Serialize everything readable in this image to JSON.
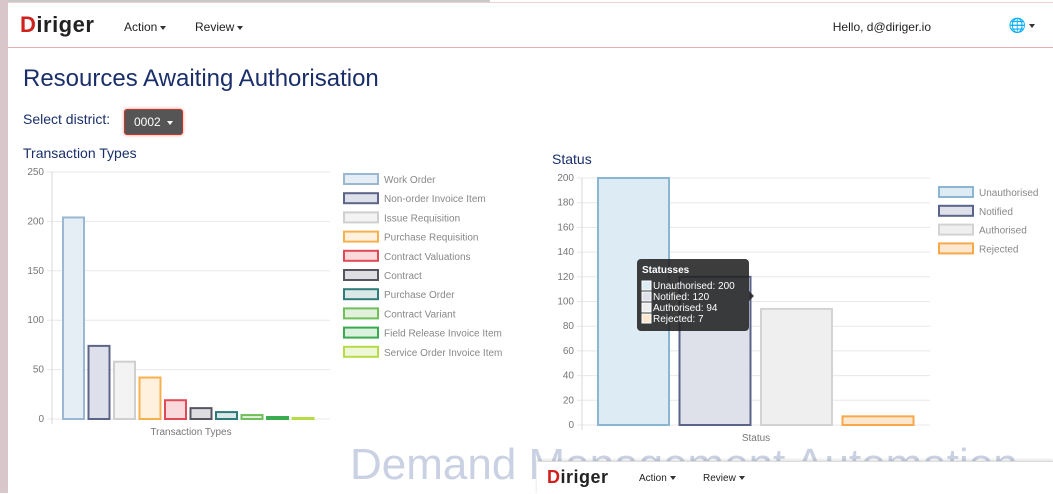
{
  "app": {
    "brand_d": "D",
    "brand_rest": "iriger"
  },
  "nav": {
    "action_label": "Action",
    "review_label": "Review",
    "hello_text": "Hello, d@diriger.io"
  },
  "page": {
    "title": "Resources Awaiting Authorisation",
    "district_label": "Select district:",
    "district_value": "0002"
  },
  "watermark": "Demand Management Automation",
  "chart_data": [
    {
      "type": "bar",
      "title": "Transaction Types",
      "xlabel": "Transaction Types",
      "ylim": [
        0,
        250
      ],
      "yticks": [
        0,
        50,
        100,
        150,
        200,
        250
      ],
      "grid": true,
      "legend": "right",
      "series": [
        {
          "name": "Work Order",
          "value": 204,
          "fill": "#e6eef5",
          "stroke": "#9ab8d1"
        },
        {
          "name": "Non-order Invoice Item",
          "value": 74,
          "fill": "#dde0ea",
          "stroke": "#5c6487"
        },
        {
          "name": "Issue Requisition",
          "value": 58,
          "fill": "#f3f3f3",
          "stroke": "#cfcfcf"
        },
        {
          "name": "Purchase Requisition",
          "value": 42,
          "fill": "#fff1de",
          "stroke": "#f6b14f"
        },
        {
          "name": "Contract Valuations",
          "value": 19,
          "fill": "#f9d9dc",
          "stroke": "#e04a56"
        },
        {
          "name": "Contract",
          "value": 11,
          "fill": "#dedee2",
          "stroke": "#555560"
        },
        {
          "name": "Purchase Order",
          "value": 7,
          "fill": "#dbe8e8",
          "stroke": "#2f7b7b"
        },
        {
          "name": "Contract Variant",
          "value": 4,
          "fill": "#e2f1dc",
          "stroke": "#6fbf5a"
        },
        {
          "name": "Field Release Invoice Item",
          "value": 2,
          "fill": "#d9f1dd",
          "stroke": "#3aab51"
        },
        {
          "name": "Service Order Invoice Item",
          "value": 1,
          "fill": "#eef8d8",
          "stroke": "#b5dc48"
        }
      ]
    },
    {
      "type": "bar",
      "title": "Status",
      "xlabel": "Status",
      "ylim": [
        0,
        200
      ],
      "yticks": [
        0,
        20,
        40,
        60,
        80,
        100,
        120,
        140,
        160,
        180,
        200
      ],
      "grid": true,
      "legend": "right",
      "series": [
        {
          "name": "Unauthorised",
          "value": 200,
          "fill": "#ddebf5",
          "stroke": "#8ab6d2"
        },
        {
          "name": "Notified",
          "value": 120,
          "fill": "#dfe1ea",
          "stroke": "#5a6389"
        },
        {
          "name": "Authorised",
          "value": 94,
          "fill": "#efefef",
          "stroke": "#d3d3d3"
        },
        {
          "name": "Rejected",
          "value": 7,
          "fill": "#fde7cf",
          "stroke": "#f6a94a"
        }
      ],
      "tooltip": {
        "title": "Statusses",
        "lines": [
          "Unauthorised: 200",
          "Notified: 120",
          "Authorised: 94",
          "Rejected: 7"
        ]
      }
    }
  ]
}
